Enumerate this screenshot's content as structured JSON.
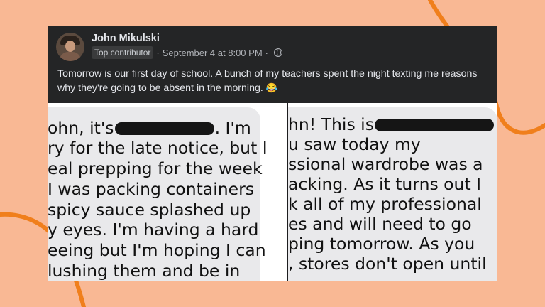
{
  "colors": {
    "background": "#f9b894",
    "accent_curve": "#f07f1c",
    "post_header_bg": "#242526",
    "bubble_bg": "#e9e9eb"
  },
  "post": {
    "author": "John Mikulski",
    "badge": "Top contributor",
    "timestamp": "September 4 at 8:00 PM",
    "separator": "·",
    "visibility_icon": "globe-icon",
    "text": "Tomorrow is our first day of school. A bunch of my teachers spent the night texting me reasons why they're going to be absent in the morning.",
    "emoji": "😂"
  },
  "screenshots": {
    "left_lines": [
      "ohn, it's",
      ". I'm",
      "ry for the late notice, but I",
      "eal prepping for the week",
      "I was packing containers",
      "spicy sauce splashed up",
      "y eyes. I'm having a hard",
      "eeing but I'm hoping I can",
      "lushing them and be in"
    ],
    "right_lines": [
      "hn! This is",
      "u saw today my",
      "ssional wardrobe was a",
      "acking. As it turns out I",
      "k all of my professional",
      "es and will need to go",
      "ping tomorrow. As you",
      ", stores don't open until"
    ]
  }
}
